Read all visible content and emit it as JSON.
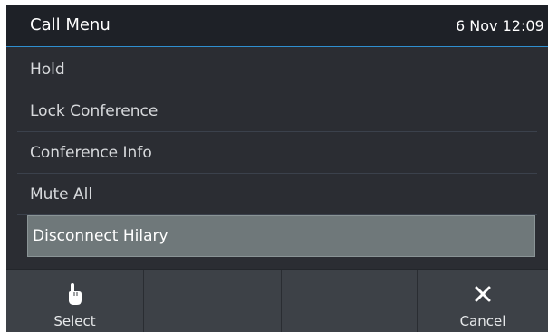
{
  "header": {
    "title": "Call Menu",
    "clock": "6 Nov 12:09"
  },
  "menu": {
    "items": [
      {
        "label": "Hold"
      },
      {
        "label": "Lock Conference"
      },
      {
        "label": "Conference Info"
      },
      {
        "label": "Mute All"
      },
      {
        "label": "Disconnect Hilary",
        "selected": true
      }
    ]
  },
  "softkeys": [
    {
      "label": "Select",
      "icon": "pointer-hand-icon"
    },
    {
      "label": ""
    },
    {
      "label": ""
    },
    {
      "label": "Cancel",
      "icon": "close-icon"
    }
  ],
  "colors": {
    "header_bg": "#1e2127",
    "accent_line": "#2f8fd0",
    "screen_bg": "#2b2d33",
    "selected_bg": "#6f787a",
    "softkey_bg": "#3d4147"
  }
}
